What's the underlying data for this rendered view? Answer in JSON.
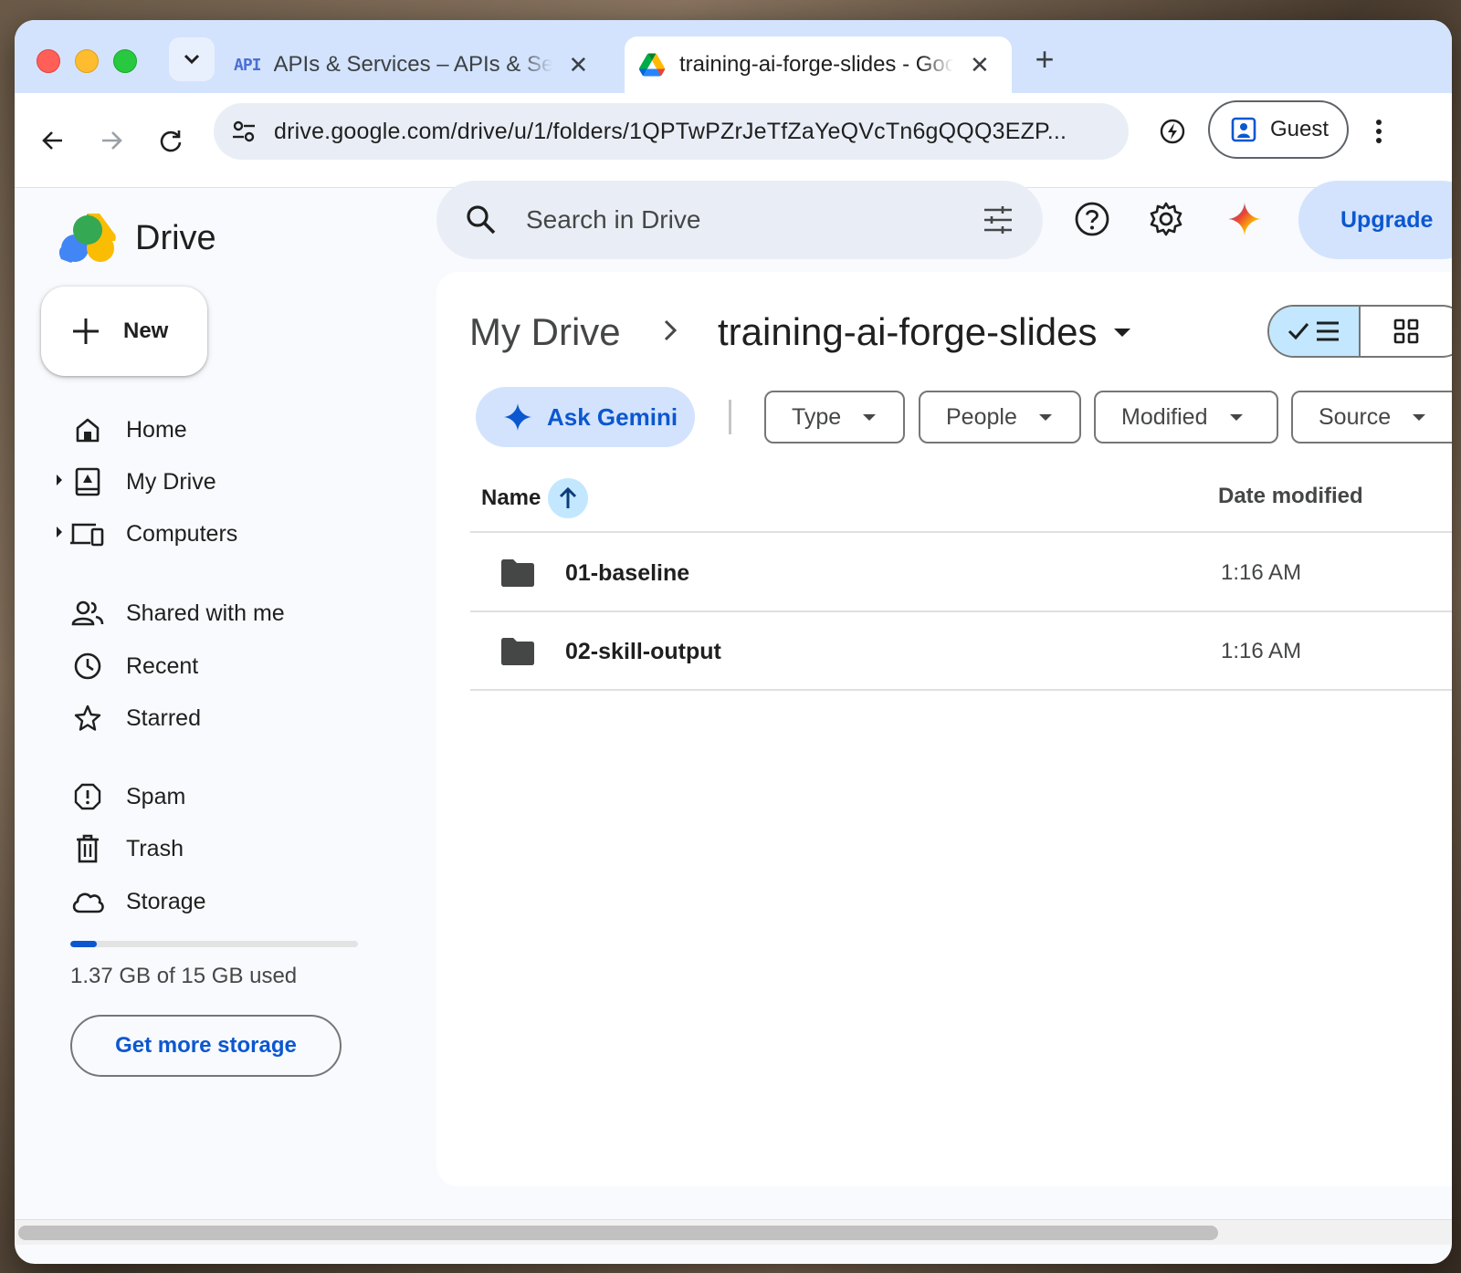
{
  "browser": {
    "tabs": [
      {
        "icon": "API",
        "title": "APIs & Services – APIs & Services – Google Cloud",
        "active": false
      },
      {
        "title": "training-ai-forge-slides - Google Drive",
        "active": true
      }
    ],
    "url": "drive.google.com/drive/u/1/folders/1QPTwPZrJeTfZaYeQVcTn6gQQQ3EZP...",
    "profile_label": "Guest"
  },
  "drive": {
    "brand": "Drive",
    "search_placeholder": "Search in Drive",
    "upgrade_label": "Upgrade",
    "new_label": "New",
    "nav": [
      {
        "label": "Home",
        "icon": "home-icon"
      },
      {
        "label": "My Drive",
        "icon": "my-drive-icon"
      },
      {
        "label": "Computers",
        "icon": "computers-icon"
      },
      {
        "label": "Shared with me",
        "icon": "shared-icon"
      },
      {
        "label": "Recent",
        "icon": "clock-icon"
      },
      {
        "label": "Starred",
        "icon": "star-icon"
      },
      {
        "label": "Spam",
        "icon": "spam-icon"
      },
      {
        "label": "Trash",
        "icon": "trash-icon"
      },
      {
        "label": "Storage",
        "icon": "cloud-icon"
      }
    ],
    "storage": {
      "used_text": "1.37 GB of 15 GB used",
      "used_fraction": 0.091,
      "cta": "Get more storage"
    },
    "breadcrumb": {
      "root": "My Drive",
      "current": "training-ai-forge-slides"
    },
    "ask_gemini": "Ask Gemini",
    "filters": [
      "Type",
      "People",
      "Modified",
      "Source"
    ],
    "columns": {
      "name": "Name",
      "date": "Date modified"
    },
    "files": [
      {
        "name": "01-baseline",
        "modified": "1:16 AM",
        "icon": "folder-icon"
      },
      {
        "name": "02-skill-output",
        "modified": "1:16 AM",
        "icon": "folder-icon"
      }
    ],
    "colors": {
      "accent": "#0b57d0",
      "chip_bg": "#d3e3fd",
      "selected": "#c2e7ff"
    }
  }
}
